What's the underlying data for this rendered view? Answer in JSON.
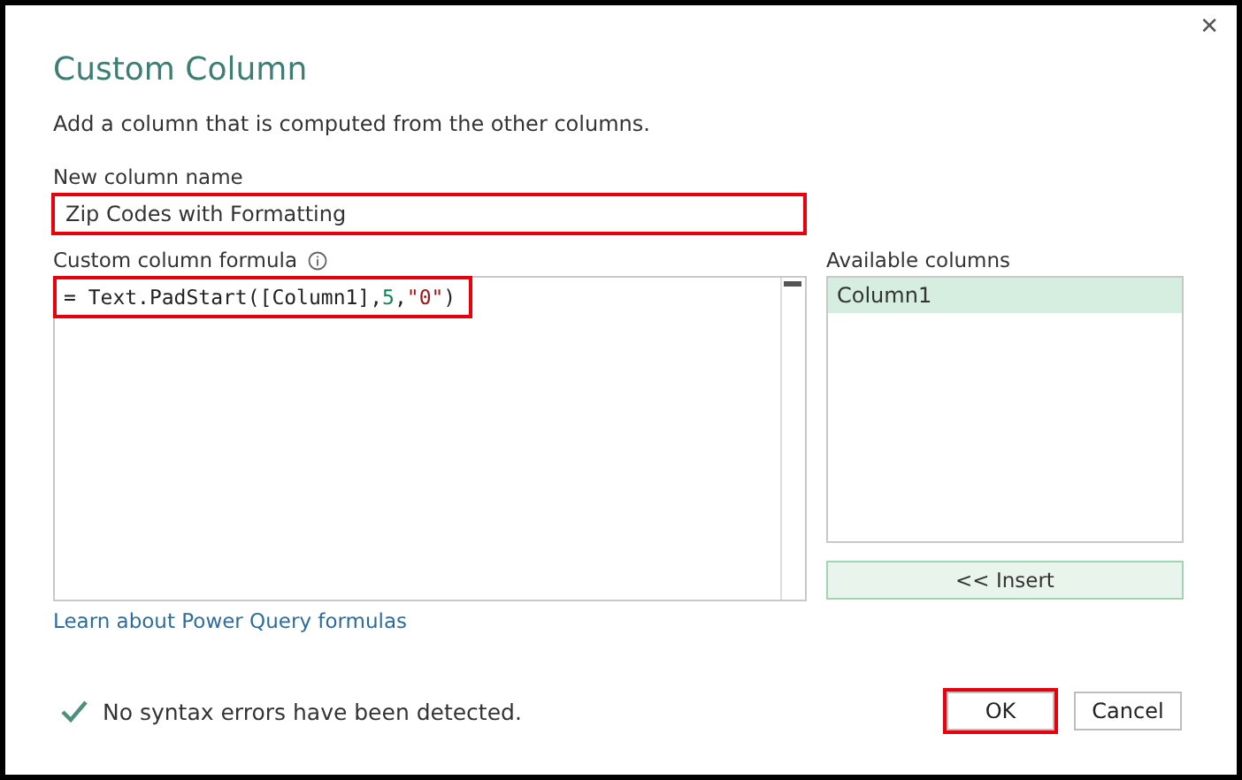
{
  "dialog": {
    "title": "Custom Column",
    "close_icon": "✕",
    "description": "Add a column that is computed from the other columns."
  },
  "name_field": {
    "label": "New column name",
    "value": "Zip Codes with Formatting",
    "highlighted": true
  },
  "formula": {
    "label": "Custom column formula",
    "highlighted": true,
    "tokens": [
      {
        "kind": "plain",
        "text": "= Text.PadStart([Column1],"
      },
      {
        "kind": "number",
        "text": "5"
      },
      {
        "kind": "plain",
        "text": ","
      },
      {
        "kind": "string",
        "text": "\"0\""
      },
      {
        "kind": "plain",
        "text": ")"
      }
    ]
  },
  "available_columns": {
    "label": "Available columns",
    "items": [
      {
        "label": "Column1",
        "selected": true
      }
    ],
    "insert_button": "<< Insert"
  },
  "link": "Learn about Power Query formulas",
  "status": {
    "ok": true,
    "message": "No syntax errors have been detected."
  },
  "buttons": [
    {
      "label": "OK",
      "highlighted": true
    },
    {
      "label": "Cancel",
      "highlighted": false
    }
  ]
}
